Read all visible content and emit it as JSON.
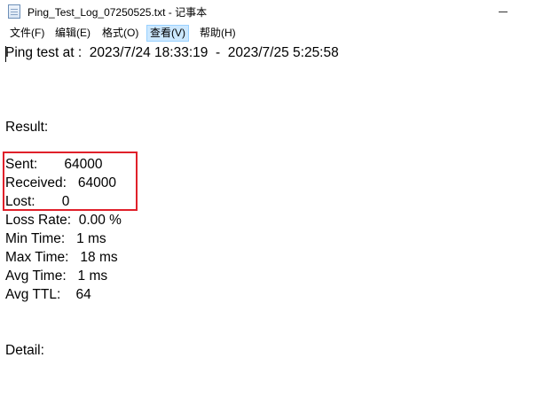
{
  "window": {
    "title": "Ping_Test_Log_07250525.txt - 记事本"
  },
  "menu": {
    "items": [
      {
        "label": "文件(F)"
      },
      {
        "label": "编辑(E)"
      },
      {
        "label": "格式(O)"
      },
      {
        "label": "查看(V)"
      },
      {
        "label": "帮助(H)"
      }
    ]
  },
  "log": {
    "header": "Ping test at :  2023/7/24 18:33:19  -  2023/7/25 5:25:58",
    "result_heading": "Result:",
    "sent": "Sent:       64000",
    "received": "Received:   64000",
    "lost": "Lost:       0",
    "loss_rate": "Loss Rate:  0.00 %",
    "min_time": "Min Time:   1 ms",
    "max_time": "Max Time:   18 ms",
    "avg_time": "Avg Time:   1 ms",
    "avg_ttl": "Avg TTL:    64",
    "detail_heading": "Detail:"
  },
  "colors": {
    "highlight_box": "#e0202a",
    "menu_active_bg": "#cce8ff"
  }
}
